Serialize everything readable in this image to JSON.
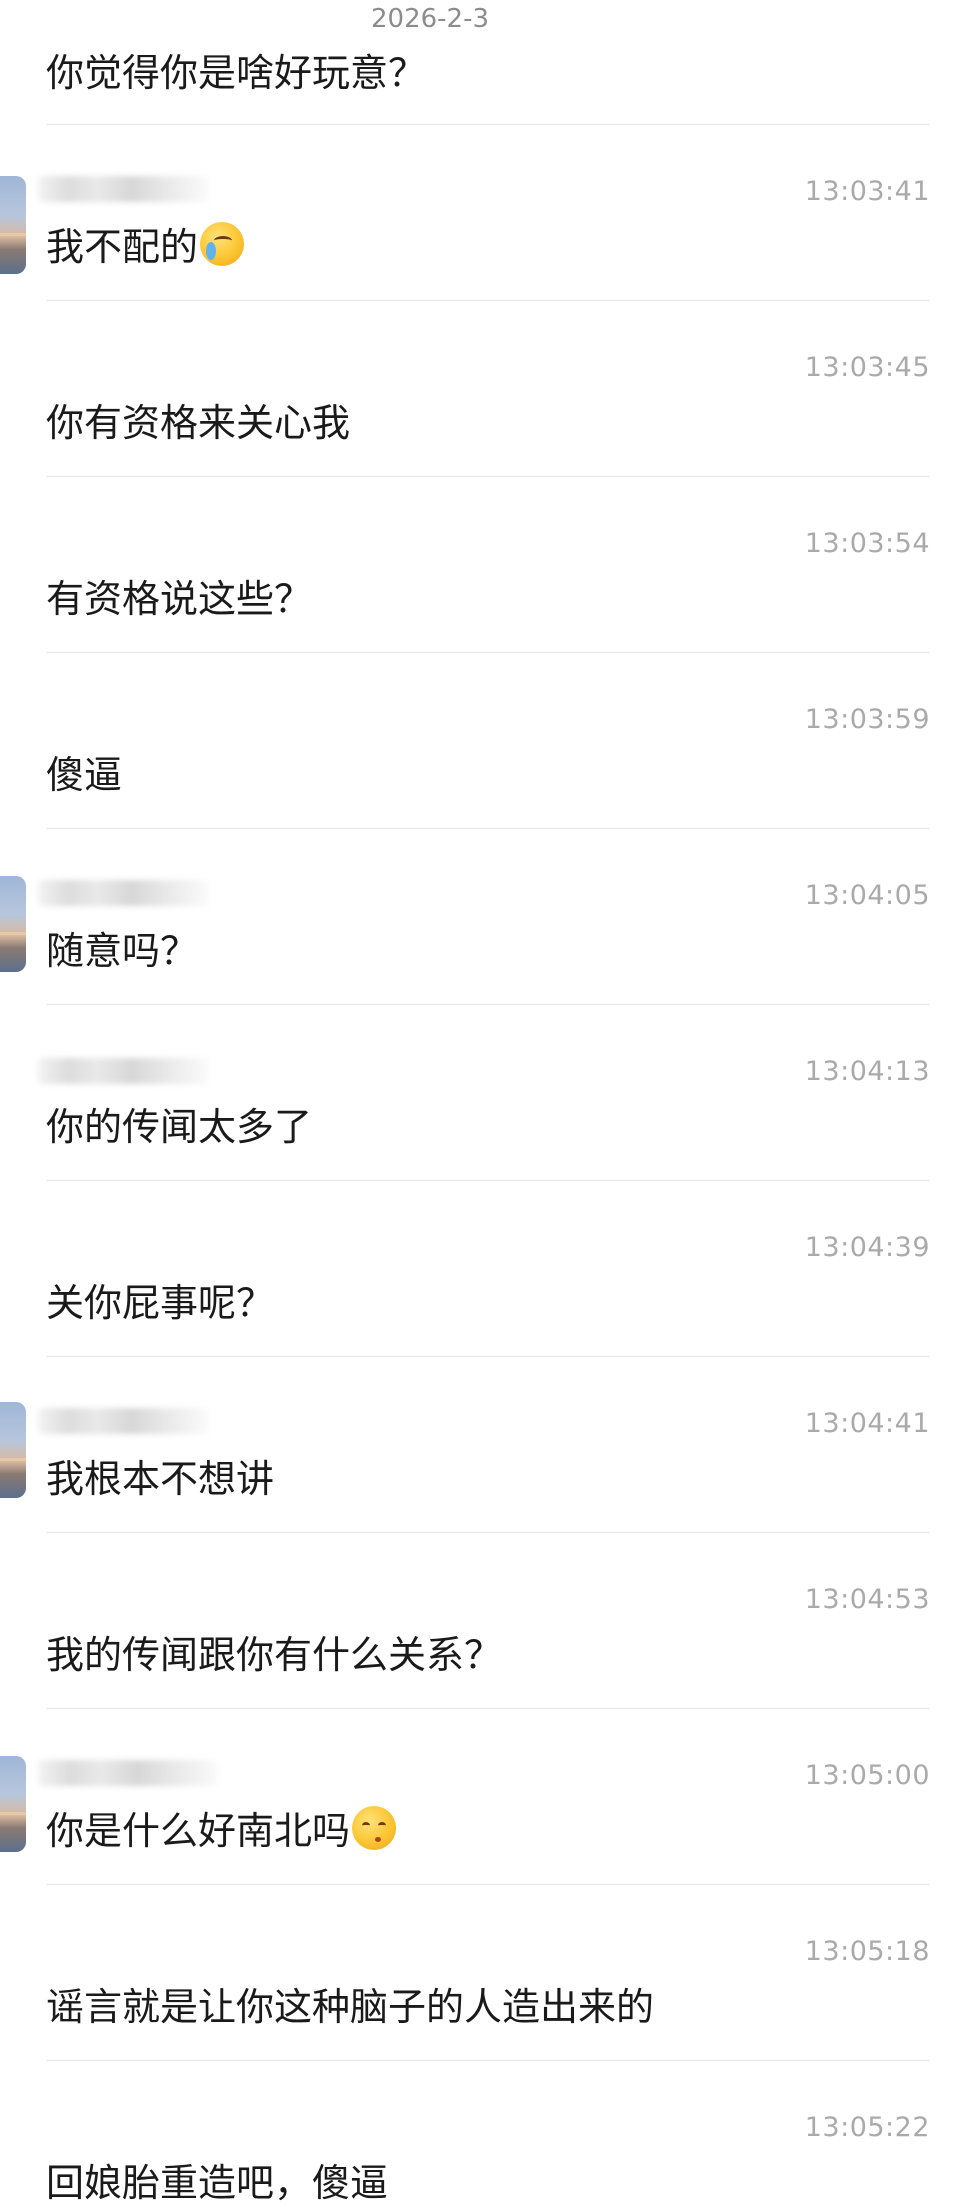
{
  "date_header": "2026-2-3",
  "first_message": {
    "text": "你觉得你是啥好玩意？"
  },
  "messages": [
    {
      "time": "13:03:41",
      "text": "我不配的",
      "emoji": "crying-emoji",
      "has_avatar": true
    },
    {
      "time": "13:03:45",
      "text": "你有资格来关心我",
      "has_avatar": false
    },
    {
      "time": "13:03:54",
      "text": "有资格说这些？",
      "has_avatar": false
    },
    {
      "time": "13:03:59",
      "text": "傻逼",
      "has_avatar": false
    },
    {
      "time": "13:04:05",
      "text": "随意吗？",
      "has_avatar": true
    },
    {
      "time": "13:04:13",
      "text": "你的传闻太多了",
      "has_avatar": false
    },
    {
      "time": "13:04:39",
      "text": "关你屁事呢？",
      "has_avatar": false
    },
    {
      "time": "13:04:41",
      "text": "我根本不想讲",
      "has_avatar": true
    },
    {
      "time": "13:04:53",
      "text": "我的传闻跟你有什么关系？",
      "has_avatar": false
    },
    {
      "time": "13:05:00",
      "text": "你是什么好南北吗",
      "emoji": "kiss-emoji",
      "has_avatar": true
    },
    {
      "time": "13:05:18",
      "text": "谣言就是让你这种脑子的人造出来的",
      "has_avatar": false
    },
    {
      "time": "13:05:22",
      "text": "回娘胎重造吧，傻逼",
      "has_avatar": false
    }
  ]
}
